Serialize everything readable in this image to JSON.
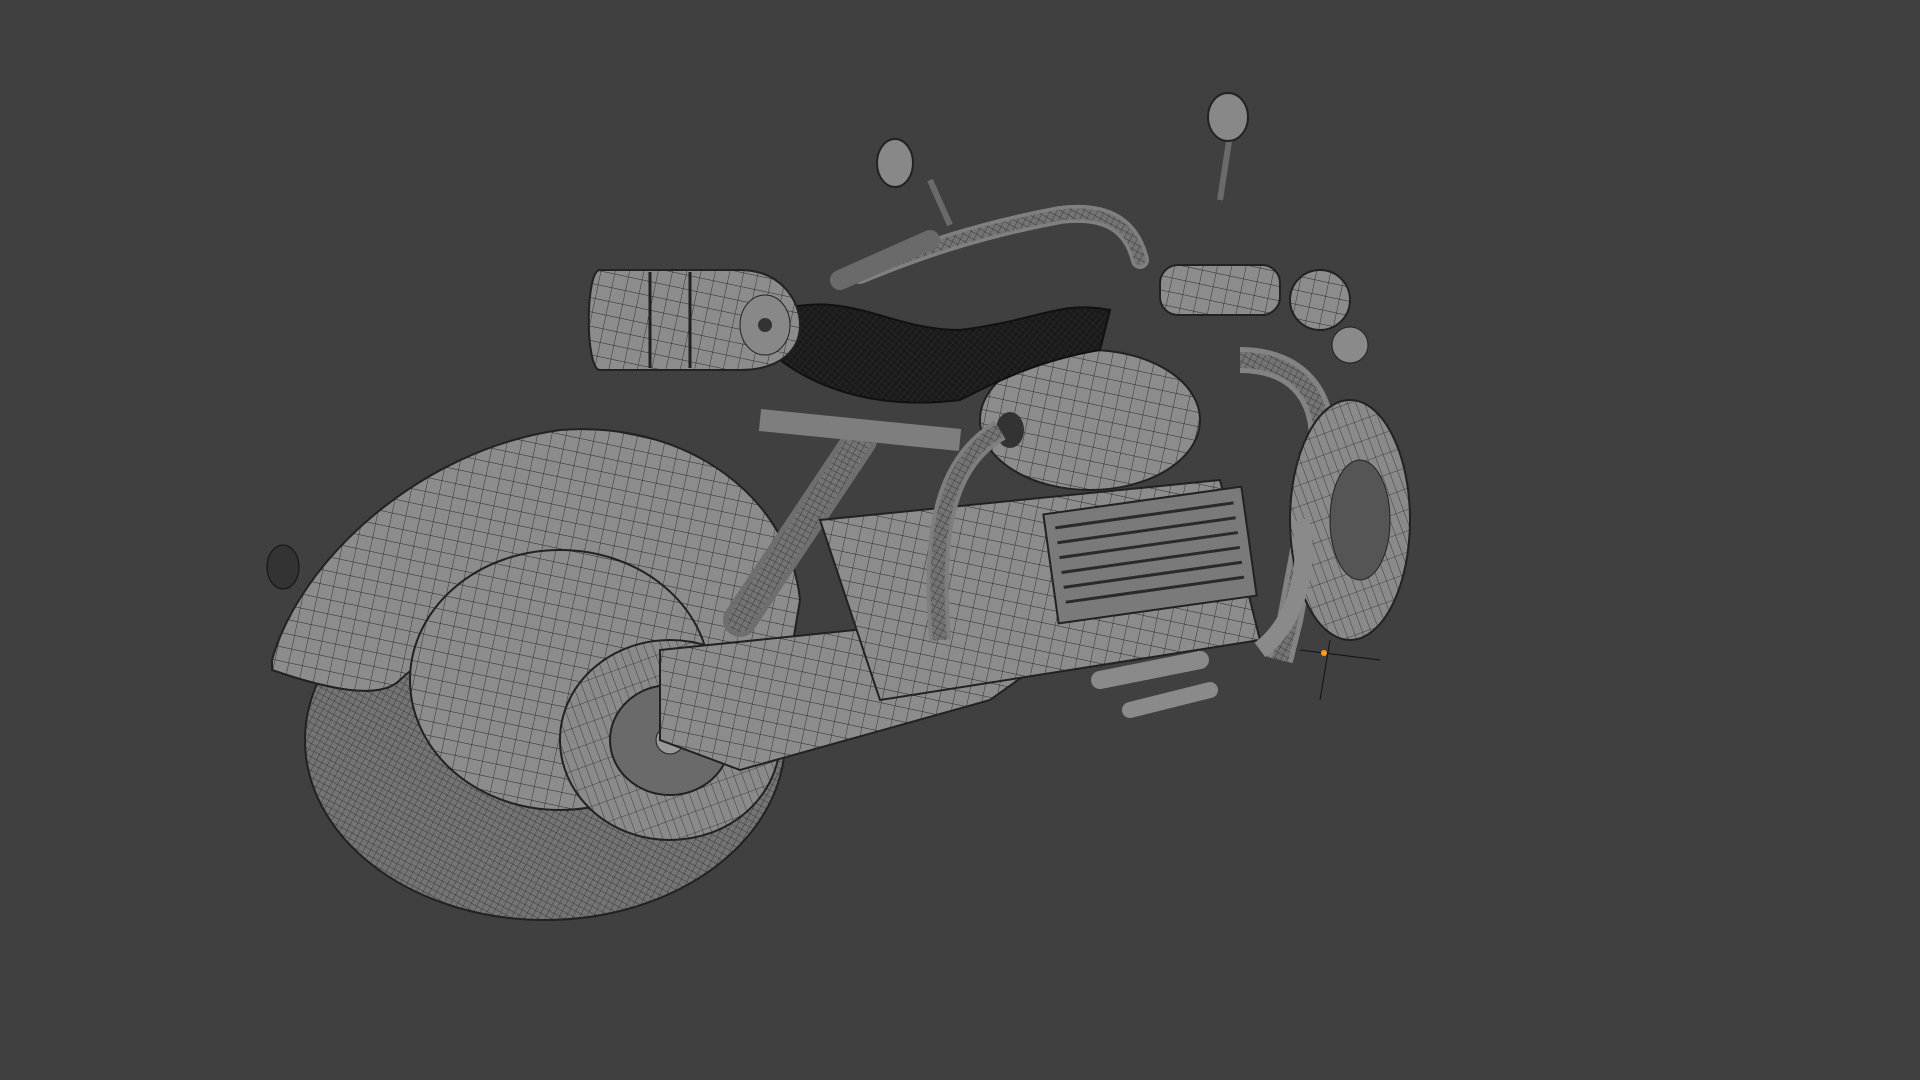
{
  "viewport": {
    "mode": "wireframe-overlay",
    "background_color": "#404040",
    "mesh_color": "#8e8e8e",
    "wire_color": "#1c1c1c",
    "origin_marker_color": "#ff9a1f"
  },
  "model": {
    "icon": "motorcycle-mesh",
    "selected": false
  }
}
